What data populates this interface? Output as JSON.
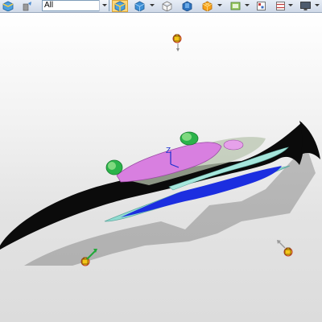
{
  "toolbar": {
    "filter_value": "All",
    "buttons": [
      {
        "name": "select-filter-icon"
      },
      {
        "name": "pick-filter-icon"
      },
      {
        "name": "display-style-icon"
      },
      {
        "name": "view-orientation-icon"
      },
      {
        "name": "wireframe-icon"
      },
      {
        "name": "section-view-icon"
      },
      {
        "name": "orientation-cube-icon"
      },
      {
        "name": "view-settings-icon"
      },
      {
        "name": "layers-icon"
      },
      {
        "name": "split-view-icon"
      },
      {
        "name": "monitor-icon"
      }
    ]
  },
  "viewport": {
    "axis_label": "Z",
    "lights": [
      "light-top",
      "light-bottom-left",
      "light-bottom-right"
    ],
    "colors": {
      "hull": "#0a0a0a",
      "body": "#d87fe0",
      "fins": "#8fdbd0",
      "wings": "#1c2ee0",
      "engines": "#2bb34a",
      "light": "#f5c518"
    }
  }
}
